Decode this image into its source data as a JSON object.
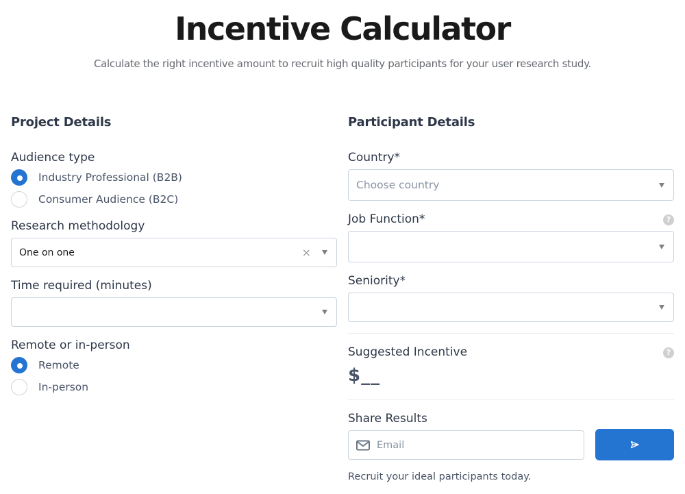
{
  "header": {
    "title": "Incentive Calculator",
    "subtitle": "Calculate the right incentive amount to recruit high quality participants for your user research study."
  },
  "project_details": {
    "heading": "Project Details",
    "audience_type": {
      "label": "Audience type",
      "options": [
        {
          "label": "Industry Professional (B2B)",
          "checked": true
        },
        {
          "label": "Consumer Audience (B2C)",
          "checked": false
        }
      ]
    },
    "research_methodology": {
      "label": "Research methodology",
      "value": "One on one"
    },
    "time_required": {
      "label": "Time required (minutes)",
      "value": ""
    },
    "remote_or_in_person": {
      "label": "Remote or in-person",
      "options": [
        {
          "label": "Remote",
          "checked": true
        },
        {
          "label": "In-person",
          "checked": false
        }
      ]
    }
  },
  "participant_details": {
    "heading": "Participant Details",
    "country": {
      "label": "Country*",
      "placeholder": "Choose country"
    },
    "job_function": {
      "label": "Job Function*",
      "value": ""
    },
    "seniority": {
      "label": "Seniority*",
      "value": ""
    }
  },
  "suggested_incentive": {
    "label": "Suggested Incentive",
    "value": "$__"
  },
  "share_results": {
    "label": "Share Results",
    "email_placeholder": "Email",
    "footer": "Recruit your ideal participants today."
  },
  "icons": {
    "help": "?",
    "clear": "×"
  },
  "colors": {
    "accent": "#2474d2",
    "text": "#2d3748",
    "muted": "#8a94a3"
  }
}
